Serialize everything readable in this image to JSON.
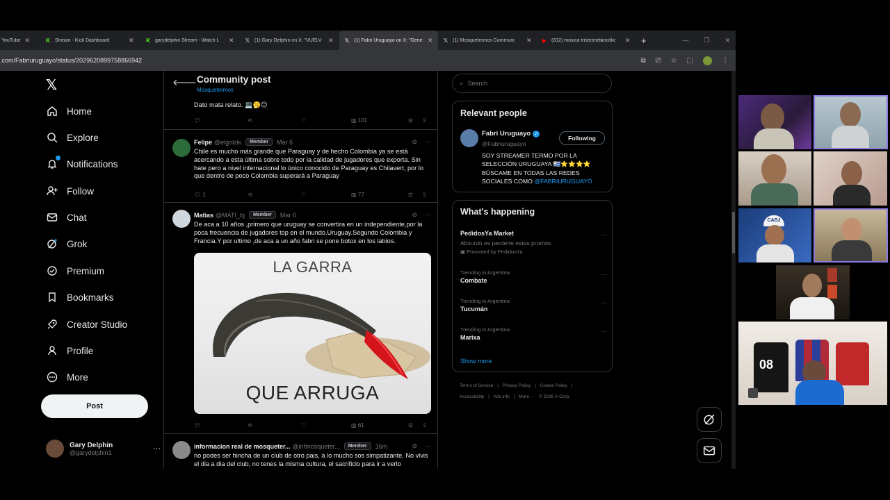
{
  "browser": {
    "tabs": [
      {
        "title": "YouTube",
        "icon": "youtube-icon"
      },
      {
        "title": "Stream - Kick Dashboard",
        "icon": "kick-icon"
      },
      {
        "title": "garydelphin Stream - Watch L",
        "icon": "kick-icon"
      },
      {
        "title": "(1) Gary Delphin on X: \"VUELV",
        "icon": "x-icon"
      },
      {
        "title": "(1) Fabri Uruguayo on X: \"Gene",
        "icon": "x-icon"
      },
      {
        "title": "(1) Mosquetermos Communi",
        "icon": "x-icon"
      },
      {
        "title": "(812) musica triste|melancólic",
        "icon": "youtube-icon"
      }
    ],
    "url": ".com/Fabriuruguayo/status/2029620899758866942"
  },
  "nav": {
    "items": [
      {
        "label": "Home",
        "icon": "home-icon"
      },
      {
        "label": "Explore",
        "icon": "search-icon"
      },
      {
        "label": "Notifications",
        "icon": "bell-icon"
      },
      {
        "label": "Follow",
        "icon": "person-plus-icon"
      },
      {
        "label": "Chat",
        "icon": "mail-icon"
      },
      {
        "label": "Grok",
        "icon": "grok-icon"
      },
      {
        "label": "Premium",
        "icon": "verified-badge-icon"
      },
      {
        "label": "Bookmarks",
        "icon": "bookmark-icon"
      },
      {
        "label": "Creator Studio",
        "icon": "rocket-icon"
      },
      {
        "label": "Profile",
        "icon": "person-icon"
      },
      {
        "label": "More",
        "icon": "more-circle-icon"
      }
    ],
    "post_label": "Post",
    "account": {
      "name": "Gary Delphin",
      "handle": "@garydelphin1"
    }
  },
  "header": {
    "title": "Community post",
    "subtitle": "Mosquetermos"
  },
  "posts": [
    {
      "body": "Dato mata relato. 💻🥱😑",
      "views": "101"
    },
    {
      "name": "Felipe",
      "handle": "@elgolzik",
      "badge": "Member",
      "date": "Mar 6",
      "body": "Chile es mucho más grande que Paraguay y de hecho Colombia ya se está acercando a esta última sobre todo por la calidad de jugadores que exporta. Sin hate pero a nivel internacional lo único conocido de Paraguay es Chilavert, por lo que dentro de poco Colombia superará a Paraguay",
      "replies": "1",
      "views": "77"
    },
    {
      "name": "Matias",
      "handle": "@MATI_bj",
      "badge": "Member",
      "date": "Mar 6",
      "body": "De aca a 10 años ,primero que uruguay se convertira en un independiente,por la poca frecuencia de jugadores top en el mundo.Uruguay.Segundo Colombia y Francia.Y por ultimo ,de aca a un año fabri se pone botox en los labios.",
      "meme_top": "LA GARRA",
      "meme_bottom": "QUE ARRUGA",
      "views": "61"
    },
    {
      "name": "informacion real de mosqueter...",
      "handle": "@infmosqueter...",
      "badge": "Member",
      "date": "16m",
      "body": "no podes ser hincha de un club de otro pais, a lo mucho sos simpatizante. No vivis el dia a dia del club, no tenes la misma cultura, el sacrificio para ir a verlo"
    }
  ],
  "search": {
    "placeholder": "Search"
  },
  "relevant": {
    "title": "Relevant people",
    "name": "Fabri Uruguayo",
    "handle": "@Fabriuruguayo",
    "follow_label": "Following",
    "bio": "SOY STREAMER TERMO POR LA SELECCIÓN URUGUAYA 🇺🇾⭐⭐⭐⭐ BÚSCAME EN TODAS LAS REDES SOCIALES COMO ",
    "bio_link": "@FABRIURUGUAYO"
  },
  "happening": {
    "title": "What's happening",
    "items": [
      {
        "context": "Absurdo es perderte estas promos",
        "topic": "PedidosYa Market",
        "promo": "Promoted by PedidosYa"
      },
      {
        "context": "Trending in Argentina",
        "topic": "Combate"
      },
      {
        "context": "Trending in Argentina",
        "topic": "Tucumán"
      },
      {
        "context": "Trending in Argentina",
        "topic": "Marixa"
      }
    ],
    "show_more": "Show more"
  },
  "footer": {
    "links": [
      "Terms of Service",
      "|",
      "Privacy Policy",
      "|",
      "Cookie Policy",
      "|",
      "Accessibility",
      "|",
      "Ads info",
      "|",
      "More ···",
      "© 2026 X Corp."
    ]
  },
  "overlay": {
    "cam_jersey_number": "08",
    "cam_cap_text": "CABJ"
  },
  "colors": {
    "accent": "#1d9bf0",
    "background": "#000000",
    "border": "#2f3336",
    "cam_highlight": "#8b7be0"
  }
}
